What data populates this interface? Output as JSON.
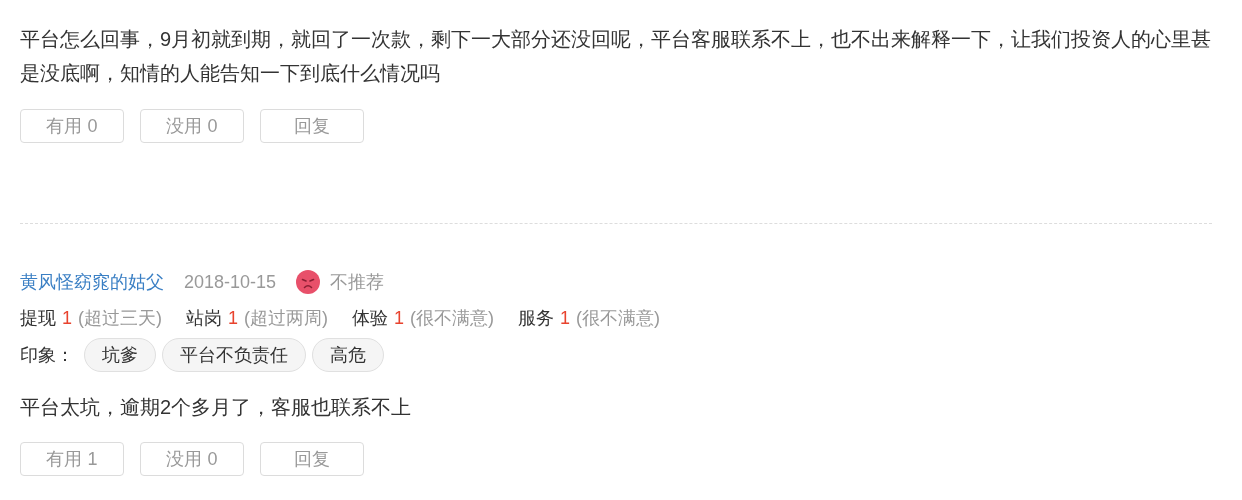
{
  "reviews": [
    {
      "text": "平台怎么回事，9月初就到期，就回了一次款，剩下一大部分还没回呢，平台客服联系不上，也不出来解释一下，让我们投资人的心里甚是没底啊，知情的人能告知一下到底什么情况吗",
      "buttons": [
        "有用 0",
        "没用 0",
        "回复"
      ]
    },
    {
      "author": "黄风怪窈窕的姑父",
      "date": "2018-10-15",
      "verdict": {
        "kind": "negative",
        "label": "不推荐"
      },
      "ratings": [
        {
          "label": "提现",
          "score": "1",
          "note": "(超过三天)"
        },
        {
          "label": "站岗",
          "score": "1",
          "note": "(超过两周)"
        },
        {
          "label": "体验",
          "score": "1",
          "note": "(很不满意)"
        },
        {
          "label": "服务",
          "score": "1",
          "note": "(很不满意)"
        }
      ],
      "impression_label": "印象：",
      "tags": [
        "坑爹",
        "平台不负责任",
        "高危"
      ],
      "text": "平台太坑，逾期2个多月了，客服也联系不上",
      "buttons": [
        "有用 1",
        "没用 0",
        "回复"
      ]
    }
  ]
}
